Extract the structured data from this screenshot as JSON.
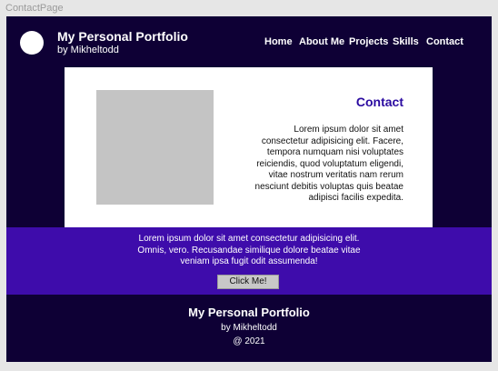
{
  "frame_label": "ContactPage",
  "header": {
    "title": "My Personal Portfolio",
    "byline": "by Mikheltodd"
  },
  "nav": [
    {
      "label": "Home"
    },
    {
      "label": "About Me"
    },
    {
      "label": "Projects"
    },
    {
      "label": "Skills"
    },
    {
      "label": "Contact"
    }
  ],
  "card": {
    "title": "Contact",
    "body_lines": [
      "Lorem ipsum dolor sit amet",
      "consectetur adipisicing elit. Facere,",
      "tempora numquam nisi voluptates",
      "reiciendis, quod voluptatum eligendi,",
      "vitae nostrum veritatis nam rerum",
      "nesciunt debitis voluptas quis beatae",
      "adipisci facilis expedita."
    ]
  },
  "band": {
    "text_lines": [
      "Lorem ipsum dolor sit amet consectetur adipisicing elit.",
      "Omnis, vero. Recusandae similique dolore beatae vitae",
      "veniam ipsa fugit odit assumenda!"
    ],
    "button_label": "Click Me!"
  },
  "footer": {
    "title": "My Personal Portfolio",
    "byline": "by Mikheltodd",
    "year": "@ 2021"
  },
  "colors": {
    "page_bg": "#0e0035",
    "band_bg": "#3e0cab",
    "accent": "#2a0aa0",
    "placeholder": "#c4c4c4"
  }
}
